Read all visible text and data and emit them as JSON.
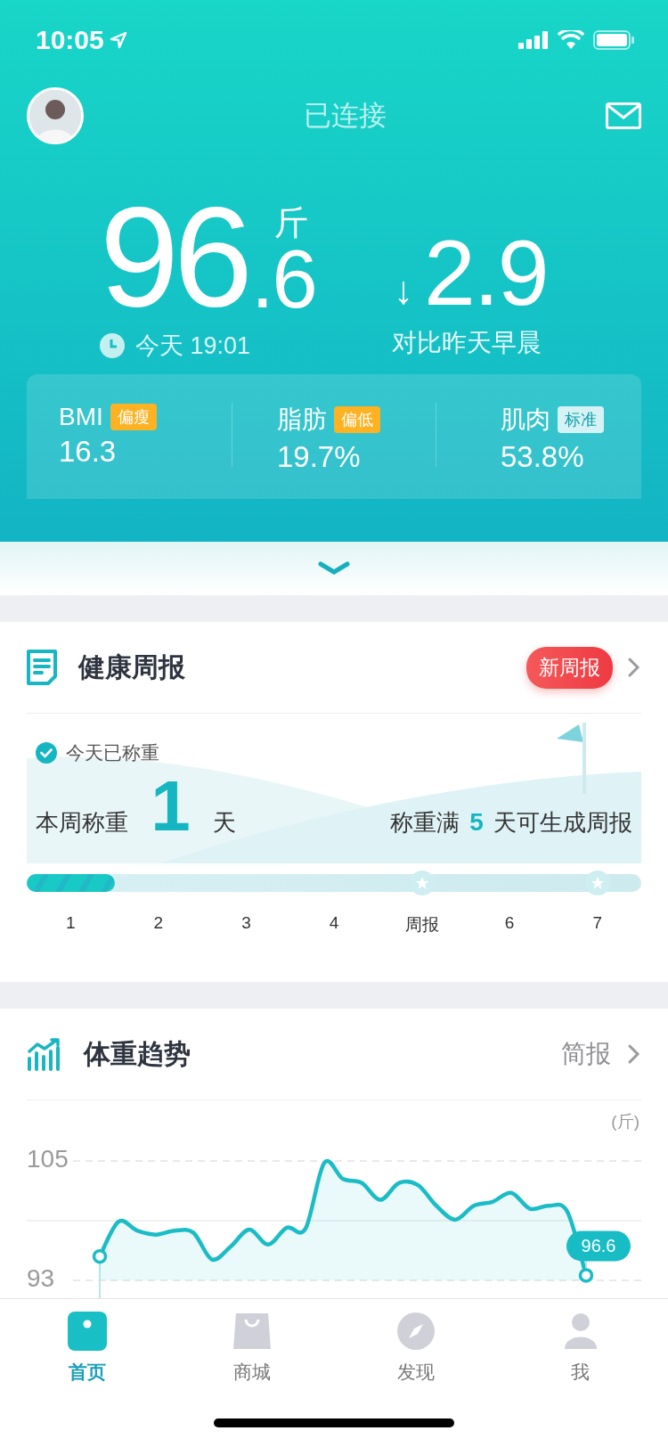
{
  "status_bar": {
    "time": "10:05"
  },
  "header": {
    "title": "已连接"
  },
  "weight": {
    "value": "96",
    "decimal": ".6",
    "unit": "斤",
    "time": "今天 19:01"
  },
  "change": {
    "arrow": "↓",
    "value": "2.9",
    "caption": "对比昨天早晨"
  },
  "metrics": [
    {
      "label": "BMI",
      "badge": "偏瘦",
      "kind": "warn",
      "value": "16.3"
    },
    {
      "label": "脂肪",
      "badge": "偏低",
      "kind": "warn",
      "value": "19.7%"
    },
    {
      "label": "肌肉",
      "badge": "标准",
      "kind": "normal",
      "value": "53.8%"
    }
  ],
  "weekly_report": {
    "title": "健康周报",
    "badge": "新周报",
    "status": "今天已称重",
    "checked": true,
    "week_count": "本周称重 **1** 天",
    "goal": "称重满 **5** 天可生成周报",
    "progress": {
      "level": 0.143
    },
    "days": [
      {
        "label": "1",
        "star": false
      },
      {
        "label": "2",
        "star": false
      },
      {
        "label": "3",
        "star": false
      },
      {
        "label": "4",
        "star": false
      },
      {
        "label": "周报",
        "star": true
      },
      {
        "label": "6",
        "star": false
      },
      {
        "label": "7",
        "star": true
      }
    ]
  },
  "weight_trend": {
    "title": "体重趋势",
    "link": "简报",
    "chart_data": {
      "type": "area",
      "ylim": [
        93,
        105
      ],
      "ylabel": "(斤)",
      "yticks": [
        {
          "value": 105,
          "label": "105"
        },
        {
          "value": 93,
          "label": "93"
        }
      ],
      "values": [
        95.4,
        98.9,
        98.0,
        97.6,
        98.0,
        97.8,
        95.1,
        96.4,
        98.1,
        96.6,
        98.3,
        98.2,
        104.8,
        103.2,
        102.8,
        101.1,
        102.8,
        102.6,
        100.5,
        99.1,
        100.5,
        100.9,
        101.8,
        100.2,
        100.5,
        99.9,
        93.5
      ],
      "annotations": [
        {
          "text": "96.6"
        }
      ]
    }
  },
  "tab_bar": [
    {
      "label": "首页",
      "selected": true
    },
    {
      "label": "商城",
      "selected": false
    },
    {
      "label": "发现",
      "selected": false
    },
    {
      "label": "我",
      "selected": false
    }
  ]
}
